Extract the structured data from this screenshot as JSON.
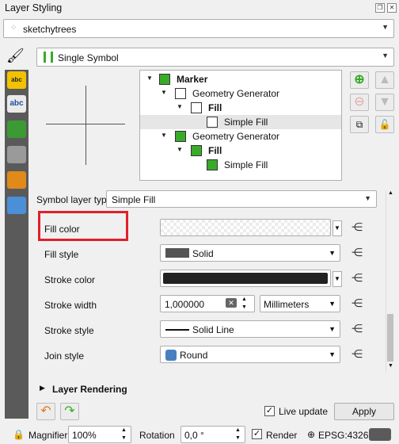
{
  "window": {
    "title": "Layer Styling"
  },
  "layer_select": {
    "value": "sketchytrees"
  },
  "renderer": {
    "value": "Single Symbol"
  },
  "symbol_tree": [
    {
      "label": "Marker",
      "bold": true,
      "fill": "green",
      "level": 0,
      "expanded": true
    },
    {
      "label": "Geometry Generator",
      "bold": false,
      "fill": "white",
      "level": 1,
      "expanded": true
    },
    {
      "label": "Fill",
      "bold": true,
      "fill": "white",
      "level": 2,
      "expanded": true
    },
    {
      "label": "Simple Fill",
      "bold": false,
      "fill": "white",
      "level": 3,
      "selected": true
    },
    {
      "label": "Geometry Generator",
      "bold": false,
      "fill": "green",
      "level": 1,
      "expanded": true
    },
    {
      "label": "Fill",
      "bold": true,
      "fill": "green",
      "level": 2,
      "expanded": true
    },
    {
      "label": "Simple Fill",
      "bold": false,
      "fill": "green",
      "level": 3
    }
  ],
  "symbol_layer_type": {
    "label": "Symbol layer type",
    "value": "Simple Fill"
  },
  "properties": {
    "fill_color": {
      "label": "Fill color"
    },
    "fill_style": {
      "label": "Fill style",
      "value": "Solid"
    },
    "stroke_color": {
      "label": "Stroke color"
    },
    "stroke_width": {
      "label": "Stroke width",
      "value": "1,000000",
      "unit": "Millimeters"
    },
    "stroke_style": {
      "label": "Stroke style",
      "value": "Solid Line"
    },
    "join_style": {
      "label": "Join style",
      "value": "Round"
    }
  },
  "layer_rendering": {
    "label": "Layer Rendering"
  },
  "live_update": {
    "label": "Live update",
    "checked": true
  },
  "apply_button": {
    "label": "Apply"
  },
  "status": {
    "magnifier_label": "Magnifier",
    "magnifier_value": "100%",
    "rotation_label": "Rotation",
    "rotation_value": "0,0 °",
    "render_label": "Render",
    "crs": "EPSG:4326"
  },
  "colors": {
    "highlight_box": "#e0202a",
    "symbol_green": "#3aaa2a",
    "sidebar": "#5a5a5a"
  }
}
